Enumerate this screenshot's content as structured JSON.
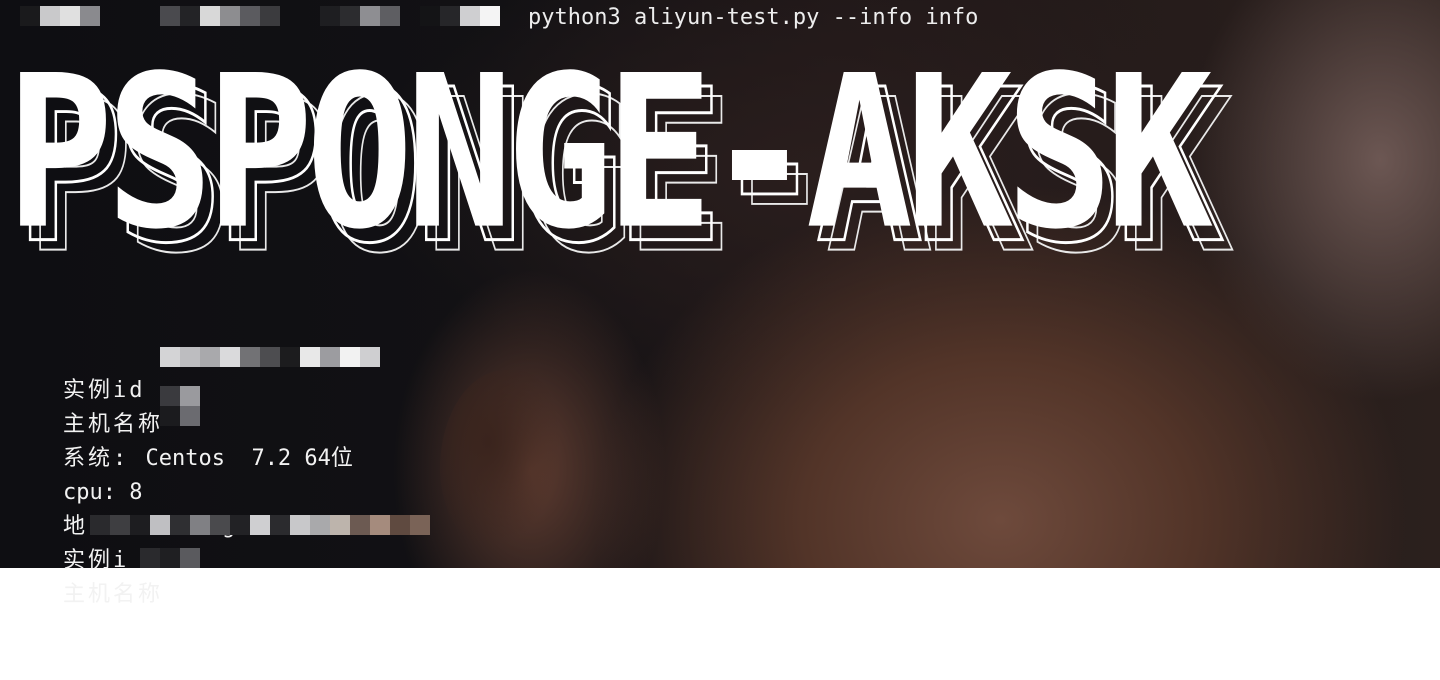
{
  "terminal": {
    "command": "python3 aliyun-test.py --info info",
    "banner": "PSPONGE-AKSK",
    "lines": [
      {
        "label": "实例id",
        "value": ""
      },
      {
        "label": "主机名称",
        "value": ""
      },
      {
        "label": "系统: ",
        "value": "Centos  7.2 64位"
      },
      {
        "label": "cpu: ",
        "value": "8"
      },
      {
        "label": "地区:",
        "value": "cn-shanghai"
      },
      {
        "label": "实例i",
        "value": ""
      },
      {
        "label": "主机名称",
        "value": ""
      }
    ]
  },
  "colors": {
    "text": "#f2f2f2",
    "banner": "#ffffff",
    "background": "#121114"
  }
}
